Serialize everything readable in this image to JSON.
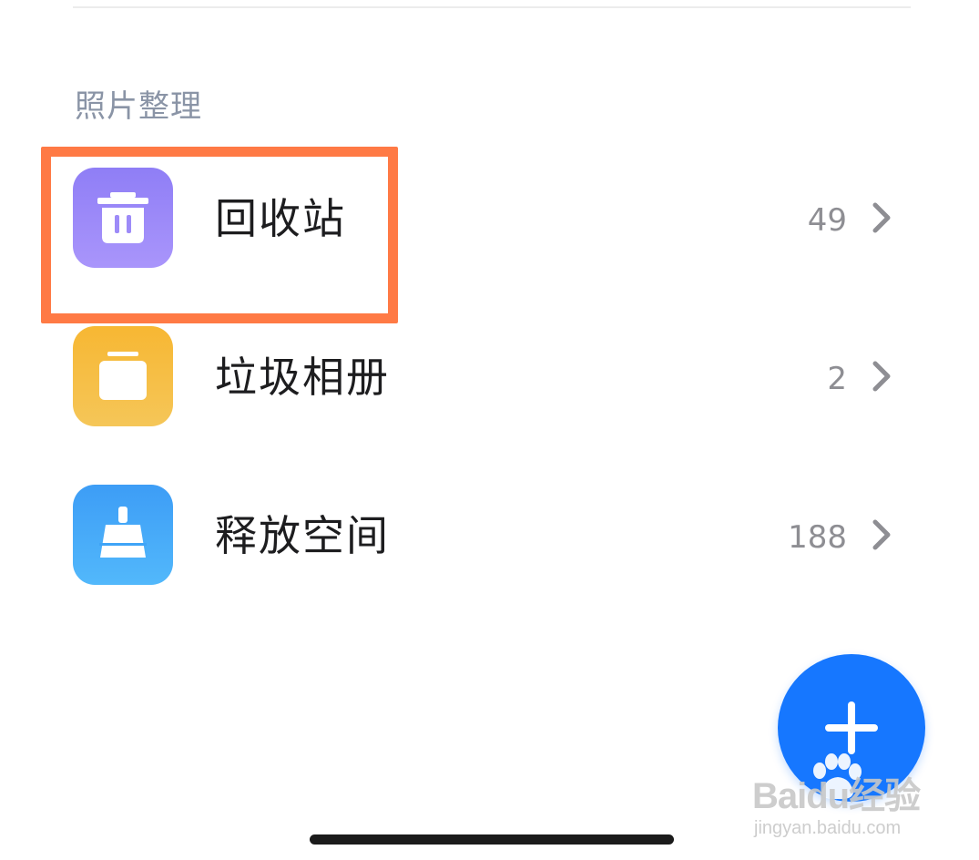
{
  "section": {
    "title": "照片整理"
  },
  "rows": [
    {
      "label": "回收站",
      "count": "49",
      "icon": "trash-icon",
      "color_top": "#8f7ef6",
      "color_bottom": "#a995fb"
    },
    {
      "label": "垃圾相册",
      "count": "2",
      "icon": "album-icon",
      "color_top": "#f7b733",
      "color_bottom": "#f5c658"
    },
    {
      "label": "释放空间",
      "count": "188",
      "icon": "broom-icon",
      "color_top": "#3d9df6",
      "color_bottom": "#52b8fb"
    }
  ],
  "fab": {
    "icon": "plus-icon",
    "color": "#1677ff"
  },
  "highlight": {
    "color": "#ff7a45"
  },
  "watermark": {
    "brand": "Baidu经验",
    "url": "jingyan.baidu.com"
  }
}
